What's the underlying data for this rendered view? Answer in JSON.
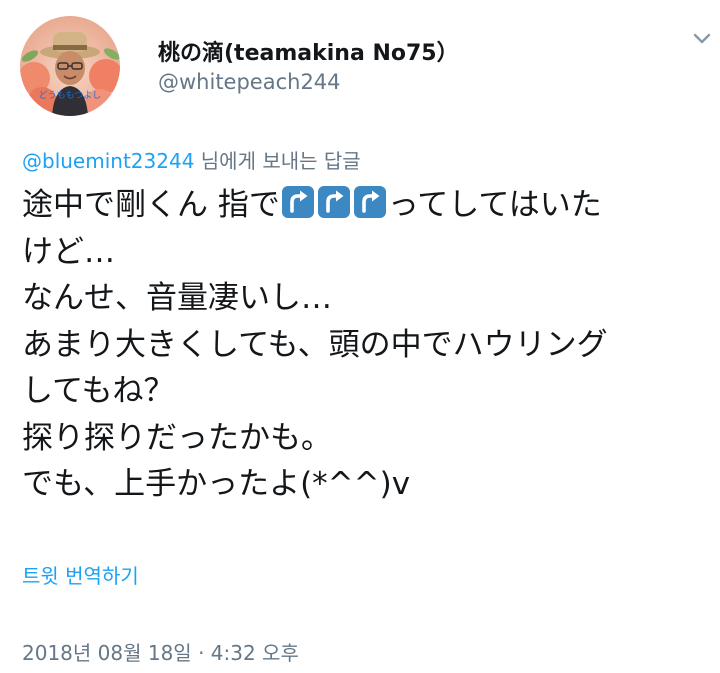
{
  "author": {
    "display_name": "桃の滴(teamakina No75）",
    "handle": "@whitepeach244",
    "avatar_caption": "どうもももつよし"
  },
  "reply": {
    "mention": "@bluemint23244",
    "suffix": " 님에게 보내는 답글"
  },
  "body": {
    "line1_before": "途中で剛くん 指で",
    "line1_emojis": [
      "up-right-arrow-emoji",
      "up-right-arrow-emoji",
      "up-right-arrow-emoji"
    ],
    "line1_after": "ってしてはいた",
    "lines": [
      "けど…",
      "なんせ、音量凄いし…",
      "あまり大きくしても、頭の中でハウリング",
      "してもね？",
      "探り探りだったかも。",
      "でも、上手かったよ(*^^)v"
    ]
  },
  "translate_label": "트윗 번역하기",
  "timestamp": "2018년 08월 18일 · 4:32 오후",
  "colors": {
    "accent": "#1da1f2",
    "secondary_text": "#657786",
    "primary_text": "#14171a",
    "emoji_bg": "#3b88c3"
  }
}
